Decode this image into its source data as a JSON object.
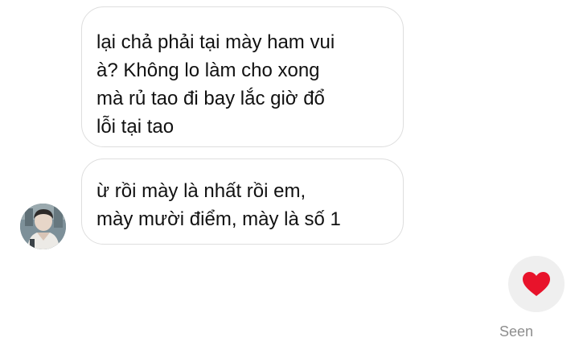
{
  "messages": [
    {
      "lines": [
        "lại chả phải tại mày ham vui",
        "à? Không lo làm cho xong",
        "mà rủ tao đi bay lắc giờ đổ",
        "lỗi tại tao"
      ]
    },
    {
      "lines": [
        "ừ rồi mày là nhất rồi em,",
        "mày mười điểm, mày là số 1"
      ]
    }
  ],
  "reaction": {
    "icon": "heart-icon",
    "color": "#e8132b"
  },
  "status": {
    "seen_label": "Seen"
  },
  "colors": {
    "bubble_border": "#dedede",
    "reaction_bg": "#efefef",
    "seen_text": "#8e8e8e"
  }
}
